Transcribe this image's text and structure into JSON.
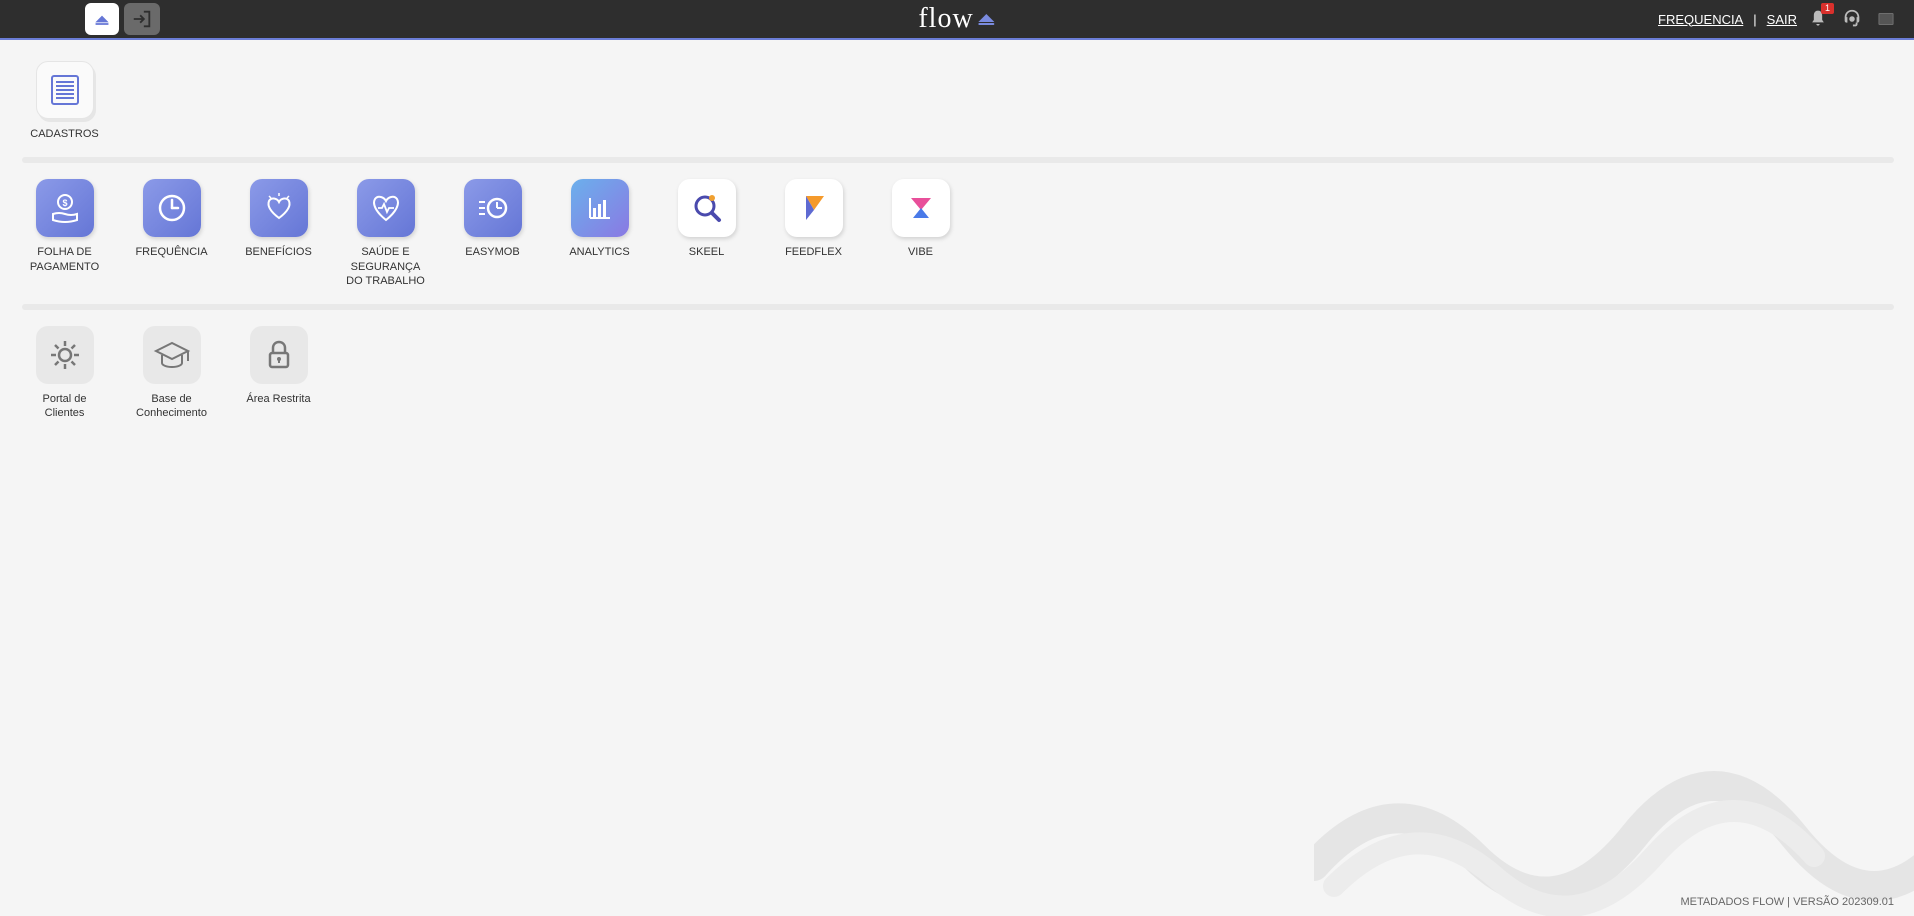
{
  "topbar": {
    "logo_text": "flow",
    "link_frequencia": "FREQUENCIA",
    "link_sair": "SAIR",
    "notification_count": "1"
  },
  "section1": {
    "tiles": [
      {
        "label": "CADASTROS"
      }
    ]
  },
  "section2": {
    "tiles": [
      {
        "label": "FOLHA DE PAGAMENTO"
      },
      {
        "label": "FREQUÊNCIA"
      },
      {
        "label": "BENEFÍCIOS"
      },
      {
        "label": "SAÚDE E SEGURANÇA DO TRABALHO"
      },
      {
        "label": "EASYMOB"
      },
      {
        "label": "ANALYTICS"
      },
      {
        "label": "SKEEL"
      },
      {
        "label": "FEEDFLEX"
      },
      {
        "label": "VIBE"
      }
    ]
  },
  "section3": {
    "tiles": [
      {
        "label": "Portal de Clientes"
      },
      {
        "label": "Base de Conhecimento"
      },
      {
        "label": "Área Restrita"
      }
    ]
  },
  "footer": {
    "text": "METADADOS FLOW | VERSÃO 202309.01"
  }
}
